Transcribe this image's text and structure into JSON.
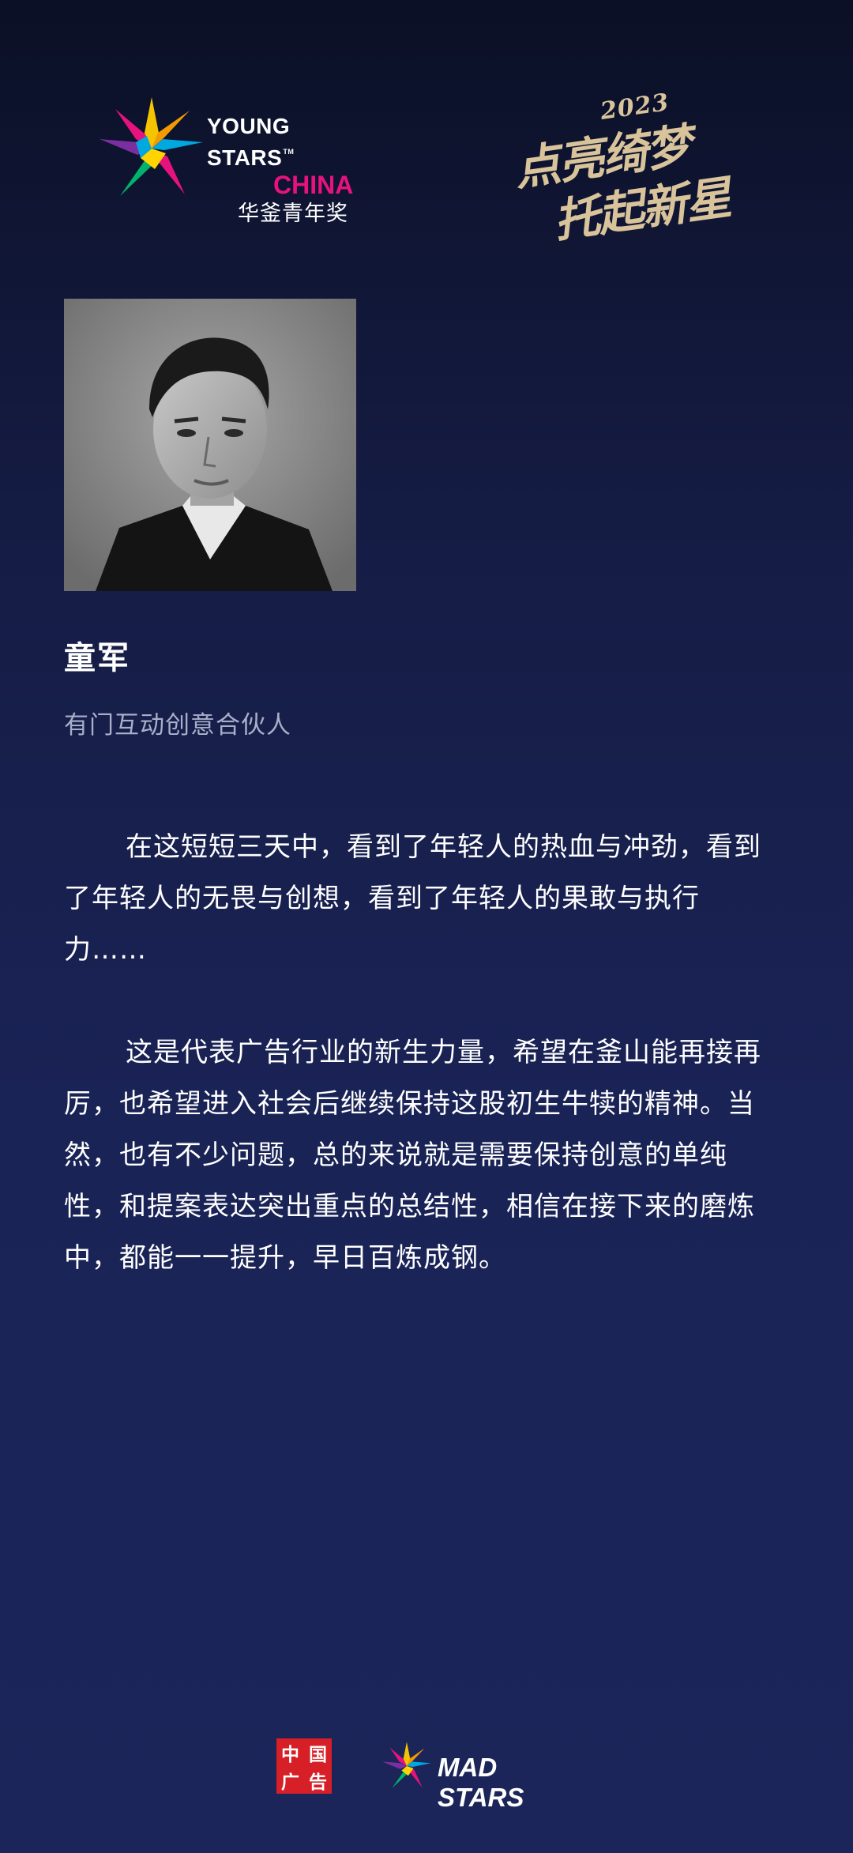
{
  "header": {
    "young_stars": {
      "line1": "YOUNG STARS",
      "tm": "TM",
      "line2": "CHINA",
      "line3": "华釜青年奖"
    },
    "campaign": {
      "year": "2023",
      "line1": "点亮绮梦",
      "line2": "托起新星"
    }
  },
  "profile": {
    "name": "童军",
    "title": "有门互动创意合伙人"
  },
  "quote": {
    "paragraphs": [
      "在这短短三天中，看到了年轻人的热血与冲劲，看到了年轻人的无畏与创想，看到了年轻人的果敢与执行力……",
      "这是代表广告行业的新生力量，希望在釜山能再接再厉，也希望进入社会后继续保持这股初生牛犊的精神。当然，也有不少问题，总的来说就是需要保持创意的单纯性，和提案表达突出重点的总结性，相信在接下来的磨炼中，都能一一提升，早日百炼成钢。"
    ]
  },
  "footer": {
    "china_ad_seal": [
      "中",
      "国",
      "广",
      "告"
    ],
    "mad_stars": "MAD STARS"
  },
  "colors": {
    "accent_magenta": "#e8127e",
    "gold": "#d8c39a",
    "seal_red": "#d61f26",
    "subtitle_gray": "#a9afc8"
  },
  "icons": [
    "young-stars-star-icon",
    "mad-stars-star-icon"
  ]
}
